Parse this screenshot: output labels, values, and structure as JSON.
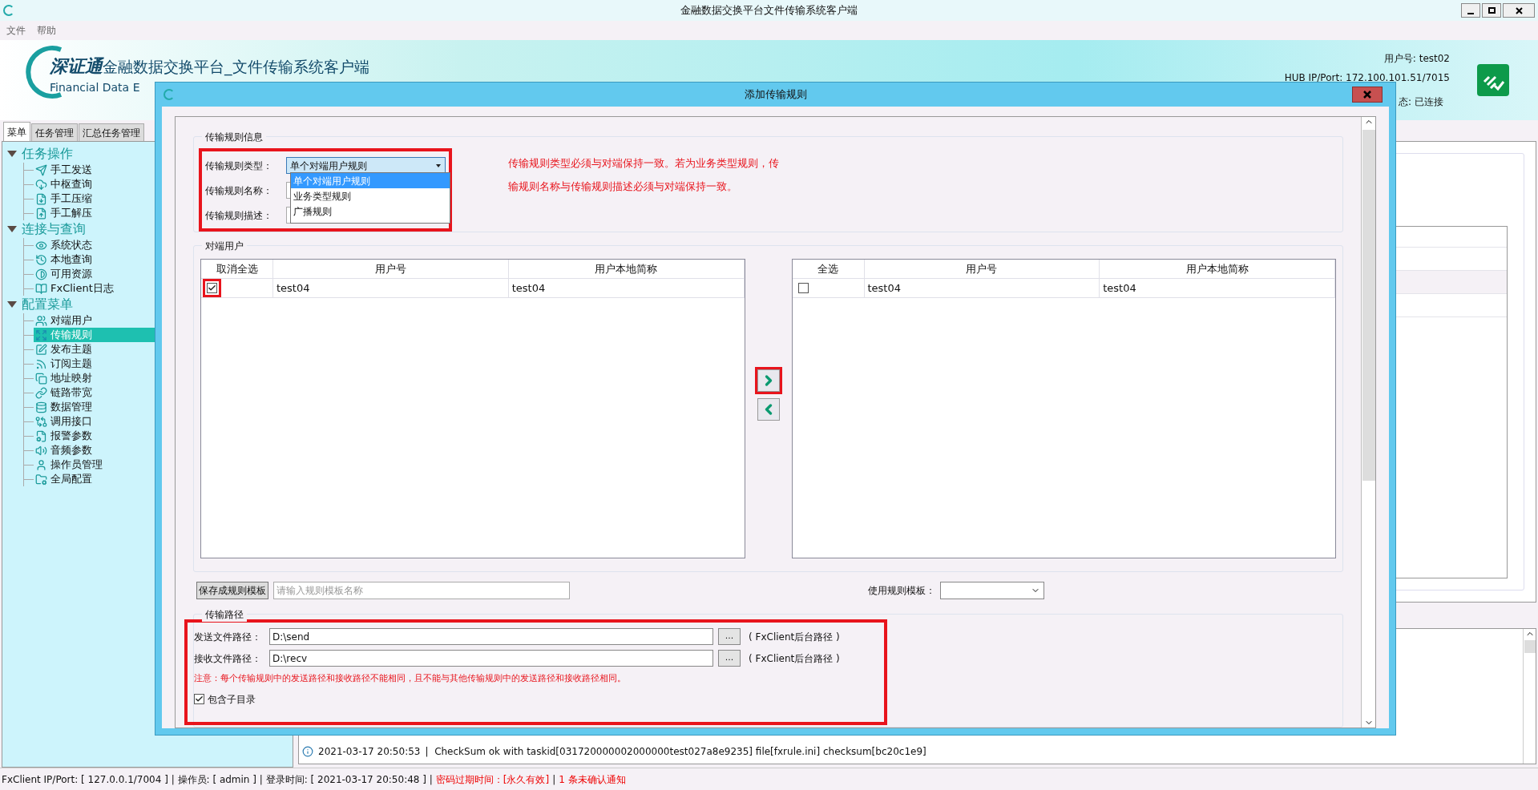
{
  "window": {
    "title": "金融数据交换平台文件传输系统客户端",
    "menu": [
      "文件",
      "帮助"
    ]
  },
  "header": {
    "brand": "深证通",
    "title": "金融数据交换平台_文件传输系统客户端",
    "subtitle": "Financial Data E",
    "user": "用户号: test02",
    "hub": "HUB IP/Port: 172.100.101.51/7015",
    "status": "态: 已连接"
  },
  "tabs": [
    {
      "label": "菜单",
      "selected": true
    },
    {
      "label": "任务管理",
      "selected": false
    },
    {
      "label": "汇总任务管理",
      "selected": false
    }
  ],
  "sidebar": {
    "groups": [
      {
        "label": "任务操作",
        "expanded": true,
        "children": [
          {
            "label": "手工发送",
            "selected": false
          },
          {
            "label": "中枢查询",
            "selected": false
          },
          {
            "label": "手工压缩",
            "selected": false
          },
          {
            "label": "手工解压",
            "selected": false
          }
        ]
      },
      {
        "label": "连接与查询",
        "expanded": true,
        "children": [
          {
            "label": "系统状态",
            "selected": false
          },
          {
            "label": "本地查询",
            "selected": false
          },
          {
            "label": "可用资源",
            "selected": false
          },
          {
            "label": "FxClient日志",
            "selected": false
          }
        ]
      },
      {
        "label": "配置菜单",
        "expanded": true,
        "children": [
          {
            "label": "对端用户",
            "selected": false
          },
          {
            "label": "传输规则",
            "selected": true
          },
          {
            "label": "发布主题",
            "selected": false
          },
          {
            "label": "订阅主题",
            "selected": false
          },
          {
            "label": "地址映射",
            "selected": false
          },
          {
            "label": "链路带宽",
            "selected": false
          },
          {
            "label": "数据管理",
            "selected": false
          },
          {
            "label": "调用接口",
            "selected": false
          },
          {
            "label": "报警参数",
            "selected": false
          },
          {
            "label": "音频参数",
            "selected": false
          },
          {
            "label": "操作员管理",
            "selected": false
          },
          {
            "label": "全局配置",
            "selected": false
          }
        ]
      }
    ]
  },
  "log": {
    "lines": [
      {
        "time": "2021-03-17 20:50:53",
        "message": "|  CheckSum ok with taskid[031720000002000000test027a8e9235] file[fxrule.ini] checksum[bc20c1e9]"
      }
    ]
  },
  "status_bar": [
    {
      "text": "FxClient IP/Port: [ 127.0.0.1/7004 ] | 操作员: [ admin ] | 登录时间: [ 2021-03-17 20:50:48 ] |",
      "alert": false
    },
    {
      "text": "密码过期时间：[永久有效]",
      "alert": true
    },
    {
      "text": "|",
      "alert": false
    },
    {
      "text": "1 条未确认通知",
      "alert": true
    }
  ],
  "dialog": {
    "title": "添加传输规则",
    "rule_info": {
      "legend": "传输规则信息",
      "highlighted": true,
      "labels": [
        "传输规则类型：",
        "传输规则名称：",
        "传输规则描述："
      ],
      "type_select": {
        "value": "单个对端用户规则",
        "expanded": true,
        "options": [
          {
            "label": "单个对端用户规则",
            "selected": true
          },
          {
            "label": "业务类型规则",
            "selected": false
          },
          {
            "label": "广播规则",
            "selected": false
          }
        ]
      },
      "note": "传输规则类型必须与对端保持一致。若为业务类型规则，传输规则名称与传输规则描述必须与对端保持一致。"
    },
    "peer_users": {
      "legend": "对端用户",
      "left_table": {
        "columns": [
          "取消全选",
          "用户号",
          "用户本地简称"
        ],
        "rows": [
          {
            "checked": true,
            "highlighted": true,
            "cells": [
              "test04",
              "test04"
            ]
          }
        ]
      },
      "right_table": {
        "columns": [
          "全选",
          "用户号",
          "用户本地简称"
        ],
        "rows": [
          {
            "checked": false,
            "cells": [
              "test04",
              "test04"
            ]
          }
        ]
      },
      "move_buttons": [
        {
          "kind": "right",
          "highlighted": true
        },
        {
          "kind": "left"
        }
      ]
    },
    "template": {
      "save_button": "保存成规则模板",
      "placeholder": "请输入规则模板名称",
      "use_label": "使用规则模板："
    },
    "paths": {
      "legend": "传输路径",
      "highlighted": true,
      "rows": [
        {
          "label": "发送文件路径：",
          "value": "D:\\send",
          "browse": "...",
          "hint": "( FxClient后台路径 )"
        },
        {
          "label": "接收文件路径：",
          "value": "D:\\recv",
          "browse": "...",
          "hint": "( FxClient后台路径 )"
        }
      ],
      "warning": "注意：每个传输规则中的发送路径和接收路径不能相同，且不能与其他传输规则中的发送路径和接收路径相同。",
      "include_subdirs": {
        "label": "包含子目录",
        "checked": true
      }
    }
  }
}
